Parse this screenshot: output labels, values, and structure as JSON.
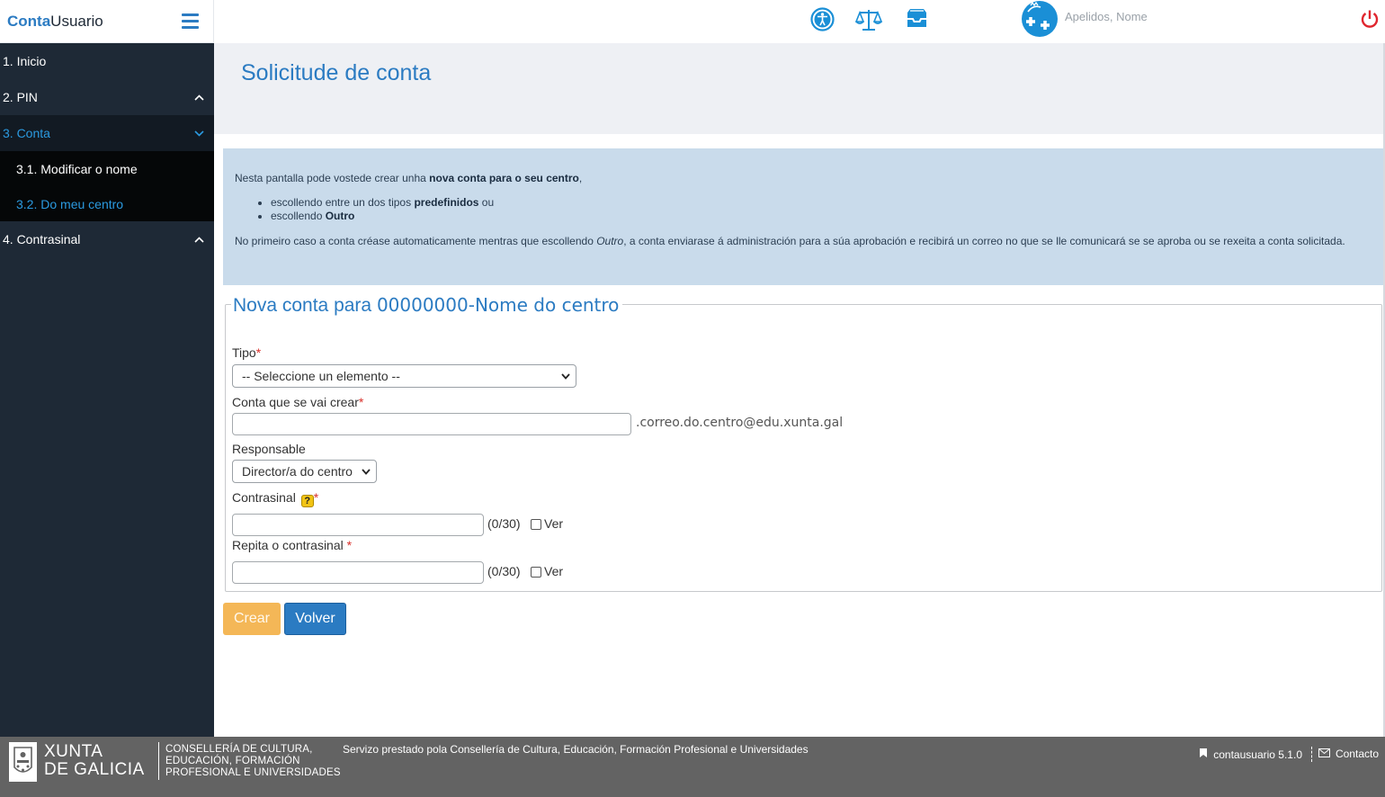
{
  "brand": {
    "part1": "Conta",
    "part2": "Usuario"
  },
  "sidebar": {
    "items": [
      {
        "label": "1. Inicio"
      },
      {
        "label": "2. PIN"
      },
      {
        "label": "3. Conta"
      },
      {
        "label": "4. Contrasinal"
      }
    ],
    "subitems": [
      {
        "label": "3.1. Modificar o nome"
      },
      {
        "label": "3.2. Do meu centro"
      }
    ]
  },
  "header": {
    "icons": [
      "accessibility-icon",
      "scales-icon",
      "inbox-icon",
      "user-avatar-icon",
      "power-icon"
    ],
    "user_name": "Apelidos, Nome"
  },
  "page": {
    "title": "Solicitude de conta"
  },
  "info": {
    "intro_pre": "Nesta pantalla pode vostede crear unha ",
    "intro_bold": "nova conta para o seu centro",
    "intro_post": ",",
    "bullet1_pre": "escollendo entre un dos tipos ",
    "bullet1_bold": "predefinidos",
    "bullet1_post": " ou",
    "bullet2_pre": "escollendo ",
    "bullet2_bold": "Outro",
    "note_pre": "No primeiro caso a conta créase automaticamente mentras que escollendo ",
    "note_italic": "Outro",
    "note_post": ", a conta enviarase á administración para a súa aprobación e recibirá un correo no que se lle comunicará se se aproba ou se rexeita a conta solicitada."
  },
  "form": {
    "legend_pre": "Nova conta para ",
    "legend_center": "00000000-Nome do centro",
    "tipo_label": "Tipo",
    "tipo_value": "-- Seleccione un elemento --",
    "conta_label": "Conta que se vai crear",
    "conta_value": "",
    "conta_suffix": ".correo.do.centro@edu.xunta.gal",
    "responsable_label": "Responsable",
    "responsable_value": "Director/a do centro",
    "contrasinal_label": "Contrasinal",
    "contrasinal_counter": "(0/30)",
    "repita_label": "Repita o contrasinal",
    "repita_counter": "(0/30)",
    "ver_label": "Ver",
    "required_mark": "*",
    "help_mark": "?"
  },
  "buttons": {
    "crear": "Crear",
    "volver": "Volver"
  },
  "footer": {
    "logo_line1": "XUNTA",
    "logo_line2": "DE GALICIA",
    "consel_line1": "CONSELLERÍA DE CULTURA,",
    "consel_line2": "EDUCACIÓN, FORMACIÓN",
    "consel_line3": "PROFESIONAL E UNIVERSIDADES",
    "served": "Servizo prestado pola Consellería de Cultura, Educación, Formación Profesional e Universidades",
    "version": "contausuario 5.1.0",
    "contact": "Contacto"
  },
  "colors": {
    "accent": "#2b7bc2",
    "sidebar": "#1e2936",
    "active": "#2b9ae0",
    "warning_button": "#f4b757",
    "power": "#e0262e"
  }
}
